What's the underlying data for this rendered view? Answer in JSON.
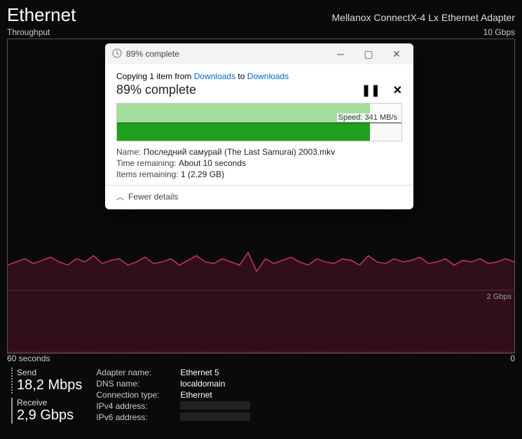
{
  "header": {
    "title": "Ethernet",
    "adapter": "Mellanox ConnectX-4 Lx Ethernet Adapter"
  },
  "chart": {
    "y_label": "Throughput",
    "y_max_label": "10 Gbps",
    "grid_label": "2 Gbps",
    "x_left": "60 seconds",
    "x_right": "0"
  },
  "stats": {
    "send_label": "Send",
    "send_value": "18,2 Mbps",
    "recv_label": "Receive",
    "recv_value": "2,9 Gbps"
  },
  "info": {
    "adapter_name_k": "Adapter name:",
    "adapter_name_v": "Ethernet 5",
    "dns_k": "DNS name:",
    "dns_v": "localdomain",
    "conn_k": "Connection type:",
    "conn_v": "Ethernet",
    "ipv4_k": "IPv4 address:",
    "ipv6_k": "IPv6 address:"
  },
  "dialog": {
    "titlebar": "89% complete",
    "copy_prefix": "Copying 1 item from ",
    "copy_from": "Downloads",
    "copy_mid": " to ",
    "copy_to": "Downloads",
    "percent": "89% complete",
    "speed_prefix": "Speed: ",
    "speed": "341 MB/s",
    "name_k": "Name:",
    "name_v": "Последний самурай (The Last Samurai)  2003.mkv",
    "time_k": "Time remaining:",
    "time_v": "About 10 seconds",
    "items_k": "Items remaining:",
    "items_v": "1 (2,29 GB)",
    "fewer": "Fewer details",
    "progress_pct": 89
  },
  "chart_data": {
    "type": "line",
    "title": "Ethernet Throughput",
    "xlabel": "seconds",
    "ylabel": "Gbps",
    "xlim": [
      60,
      0
    ],
    "ylim": [
      0,
      10
    ],
    "series": [
      {
        "name": "Receive",
        "values": [
          2.8,
          2.9,
          3.0,
          2.85,
          2.95,
          3.05,
          2.9,
          2.8,
          3.0,
          2.9,
          3.1,
          2.85,
          2.95,
          3.0,
          2.8,
          2.9,
          3.05,
          2.85,
          2.9,
          3.0,
          2.8,
          2.95,
          3.1,
          2.9,
          2.85,
          3.0,
          2.9,
          2.8,
          3.2,
          2.6,
          3.0,
          2.85,
          2.95,
          3.05,
          2.9,
          2.8,
          3.0,
          2.9,
          2.85,
          3.0,
          2.95,
          2.8,
          3.1,
          2.9,
          2.85,
          3.0,
          2.9,
          2.95,
          3.05,
          2.85,
          2.9,
          3.0,
          2.8,
          2.95,
          2.9,
          3.0,
          2.85,
          2.9,
          3.0,
          2.9
        ]
      },
      {
        "name": "Send",
        "values": [
          0.02,
          0.02,
          0.02,
          0.02,
          0.02,
          0.02,
          0.02,
          0.02,
          0.02,
          0.02,
          0.02,
          0.02,
          0.02,
          0.02,
          0.02,
          0.02,
          0.02,
          0.02,
          0.02,
          0.02,
          0.02,
          0.02,
          0.02,
          0.02,
          0.02,
          0.02,
          0.02,
          0.02,
          0.02,
          0.02,
          0.02,
          0.02,
          0.02,
          0.02,
          0.02,
          0.02,
          0.02,
          0.02,
          0.02,
          0.02,
          0.02,
          0.02,
          0.02,
          0.02,
          0.02,
          0.02,
          0.02,
          0.02,
          0.02,
          0.02,
          0.02,
          0.02,
          0.02,
          0.02,
          0.02,
          0.02,
          0.02,
          0.02,
          0.02,
          0.02
        ]
      }
    ]
  }
}
